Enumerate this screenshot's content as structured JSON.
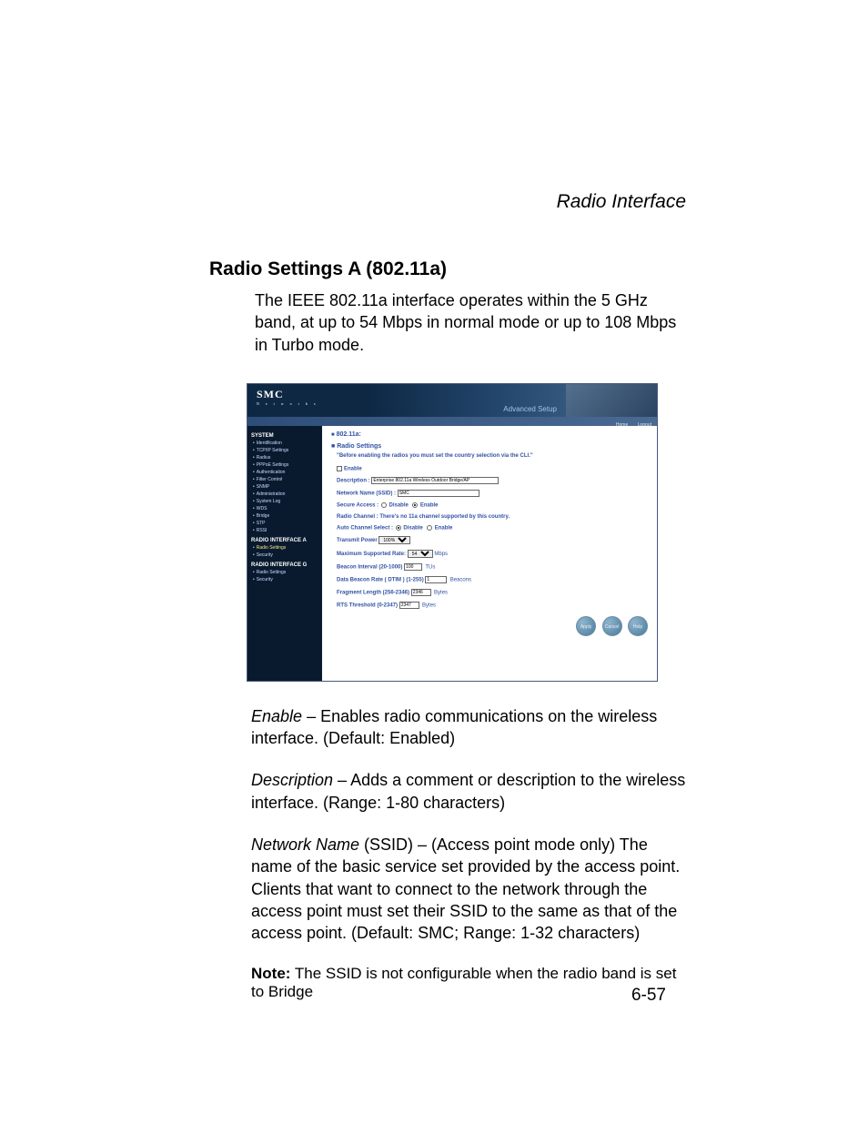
{
  "header": {
    "title": "Radio Interface"
  },
  "section": {
    "title_bold": "Radio Settings A",
    "title_rest": " (802.11a)",
    "intro": "The IEEE 802.11a interface operates within the 5 GHz band, at up to 54 Mbps in normal mode or up to 108 Mbps in Turbo mode."
  },
  "screenshot": {
    "logo": "SMC",
    "logo_sub": "N e t w o r k s",
    "top_text": "Advanced Setup",
    "bar": {
      "home": "Home",
      "logout": "Logout"
    },
    "sidebar": {
      "group1_head": "SYSTEM",
      "group1": [
        "Identification",
        "TCP/IP Settings",
        "Radius",
        "PPPoE Settings",
        "Authentication",
        "Filter Control",
        "SNMP",
        "Administration",
        "System Log",
        "WDS",
        "Bridge",
        "STP",
        "RSSI"
      ],
      "group2_head": "RADIO INTERFACE A",
      "group2": [
        "Radio Settings",
        "Security"
      ],
      "group3_head": "RADIO INTERFACE G",
      "group3": [
        "Radio Settings",
        "Security"
      ]
    },
    "main": {
      "breadcrumb": "802.11a:",
      "section": "Radio Settings",
      "warning": "\"Before enabling the radios you must set the country selection via the CLI.\"",
      "enable_label": "Enable",
      "description_label": "Description :",
      "description_value": "Enterprise 802.11a Wireless Outdoor Bridge/AP",
      "ssid_label": "Network Name (SSID) :",
      "ssid_value": "SMC",
      "secure_label": "Secure Access :",
      "disable": "Disable",
      "enable": "Enable",
      "channel_label": "Radio Channel : There's no 11a channel supported by this country.",
      "auto_channel_label": "Auto Channel Select :",
      "tx_power_label": "Transmit Power",
      "tx_power_value": "100%",
      "max_rate_label": "Maximum Supported Rate:",
      "max_rate_value": "54",
      "max_rate_unit": "Mbps",
      "beacon_label": "Beacon Interval (20-1000)",
      "beacon_value": "100",
      "beacon_unit": "TUs",
      "dtim_label": "Data Beacon Rate ( DTIM ) (1-255)",
      "dtim_value": "1",
      "dtim_unit": "Beacons",
      "frag_label": "Fragment Length (256-2346)",
      "frag_value": "2346",
      "frag_unit": "Bytes",
      "rts_label": "RTS Threshold (0-2347)",
      "rts_value": "2347",
      "rts_unit": "Bytes",
      "buttons": {
        "apply": "Apply",
        "cancel": "Cancel",
        "help": "Help"
      }
    }
  },
  "body": {
    "enable_term": "Enable",
    "enable_text": " – Enables radio communications on the wireless interface. (Default: Enabled)",
    "desc_term": "Description",
    "desc_text": " – Adds a comment or description to the wireless interface. (Range: 1-80 characters)",
    "nn_term": "Network Name",
    "nn_text": " (SSID) – (Access point mode only) The name of the basic service set provided by the access point. Clients that want to connect to the network through the access point must set their SSID to the same as that of the access point. (Default: SMC; Range: 1-32 characters)",
    "note_label": "Note:",
    "note_text": "  The SSID is not configurable when the radio band is set to Bridge"
  },
  "page_number": "6-57"
}
